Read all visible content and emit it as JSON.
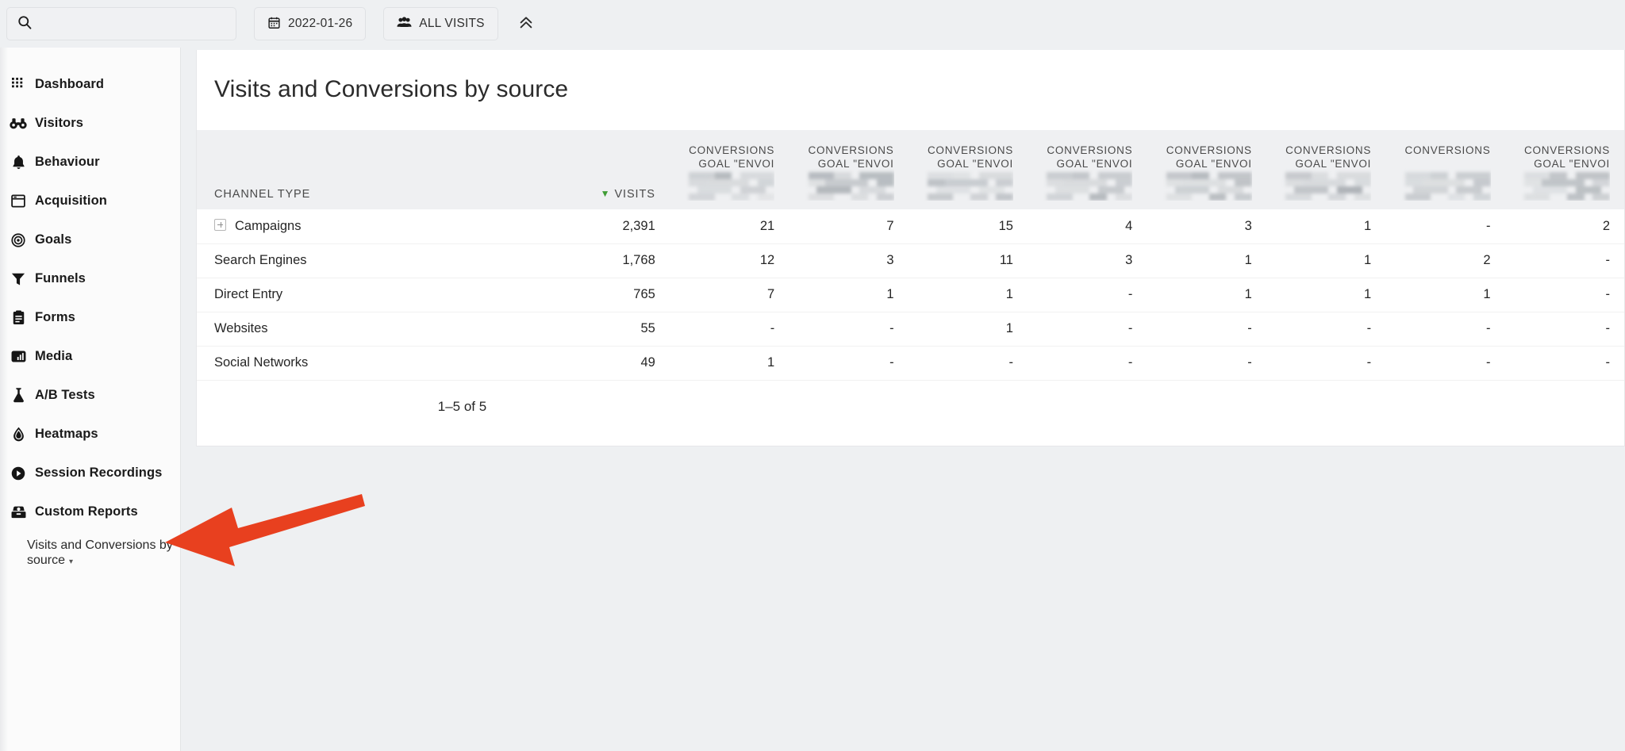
{
  "topbar": {
    "search": {
      "value": "",
      "placeholder": "",
      "icon": "search-icon"
    },
    "date_filter": {
      "label": "2022-01-26",
      "icon": "calendar-icon"
    },
    "segment_filter": {
      "label": "ALL VISITS",
      "icon": "visitors-group-icon"
    },
    "collapse": {
      "icon": "chevron-double-up-icon"
    }
  },
  "sidebar": {
    "items": [
      {
        "label": "Dashboard",
        "icon": "grid-dots-icon"
      },
      {
        "label": "Visitors",
        "icon": "binoculars-icon"
      },
      {
        "label": "Behaviour",
        "icon": "bell-icon"
      },
      {
        "label": "Acquisition",
        "icon": "browser-window-icon"
      },
      {
        "label": "Goals",
        "icon": "target-icon"
      },
      {
        "label": "Funnels",
        "icon": "funnel-icon"
      },
      {
        "label": "Forms",
        "icon": "clipboard-icon"
      },
      {
        "label": "Media",
        "icon": "media-bars-icon"
      },
      {
        "label": "A/B Tests",
        "icon": "flask-icon"
      },
      {
        "label": "Heatmaps",
        "icon": "droplet-icon"
      },
      {
        "label": "Session Recordings",
        "icon": "play-circle-icon"
      },
      {
        "label": "Custom Reports",
        "icon": "report-box-icon"
      }
    ],
    "sub_item": {
      "label": "Visits and Conversions by source",
      "caret": "▾"
    }
  },
  "report": {
    "title": "Visits and Conversions by source",
    "columns": [
      {
        "key": "channel",
        "label": "CHANNEL TYPE",
        "align": "left"
      },
      {
        "key": "visits",
        "label": "VISITS",
        "align": "right",
        "sorted": true,
        "sort_dir": "desc"
      },
      {
        "key": "conv1",
        "line1": "CONVERSIONS",
        "line2": "GOAL \"ENVOI",
        "align": "right",
        "redacted": true
      },
      {
        "key": "conv2",
        "line1": "CONVERSIONS",
        "line2": "GOAL \"ENVOI",
        "align": "right",
        "redacted": true
      },
      {
        "key": "conv3",
        "line1": "CONVERSIONS",
        "line2": "GOAL \"ENVOI",
        "align": "right",
        "redacted": true
      },
      {
        "key": "conv4",
        "line1": "CONVERSIONS",
        "line2": "GOAL \"ENVOI",
        "align": "right",
        "redacted": true
      },
      {
        "key": "conv5",
        "line1": "CONVERSIONS",
        "line2": "GOAL \"ENVOI",
        "align": "right",
        "redacted": true
      },
      {
        "key": "conv6",
        "line1": "CONVERSIONS",
        "line2": "GOAL \"ENVOI",
        "align": "right",
        "redacted": true
      },
      {
        "key": "conv7",
        "line1": "CONVERSIONS",
        "line2": "",
        "align": "right",
        "redacted": true
      },
      {
        "key": "conv8",
        "line1": "CONVERSIONS",
        "line2": "GOAL \"ENVOI",
        "align": "right",
        "redacted": true
      }
    ],
    "rows": [
      {
        "channel": "Campaigns",
        "expandable": true,
        "visits": "2,391",
        "values": [
          "21",
          "7",
          "15",
          "4",
          "3",
          "1",
          "-",
          "2"
        ]
      },
      {
        "channel": "Search Engines",
        "expandable": false,
        "visits": "1,768",
        "values": [
          "12",
          "3",
          "11",
          "3",
          "1",
          "1",
          "2",
          "-"
        ]
      },
      {
        "channel": "Direct Entry",
        "expandable": false,
        "visits": "765",
        "values": [
          "7",
          "1",
          "1",
          "-",
          "1",
          "1",
          "1",
          "-"
        ]
      },
      {
        "channel": "Websites",
        "expandable": false,
        "visits": "55",
        "values": [
          "-",
          "-",
          "1",
          "-",
          "-",
          "-",
          "-",
          "-"
        ]
      },
      {
        "channel": "Social Networks",
        "expandable": false,
        "visits": "49",
        "values": [
          "1",
          "-",
          "-",
          "-",
          "-",
          "-",
          "-",
          "-"
        ]
      }
    ],
    "pagination": {
      "label": "1–5 of 5"
    }
  },
  "annotation": {
    "arrow": {
      "color": "#e8401f",
      "points_to": "sidebar-sub-item-visits-and-conversions"
    }
  },
  "colors": {
    "accent_green": "#3f9c35",
    "arrow_red": "#e8401f",
    "page_bg": "#eef0f2",
    "card_bg": "#ffffff",
    "sidebar_bg": "#fbfbfb"
  }
}
